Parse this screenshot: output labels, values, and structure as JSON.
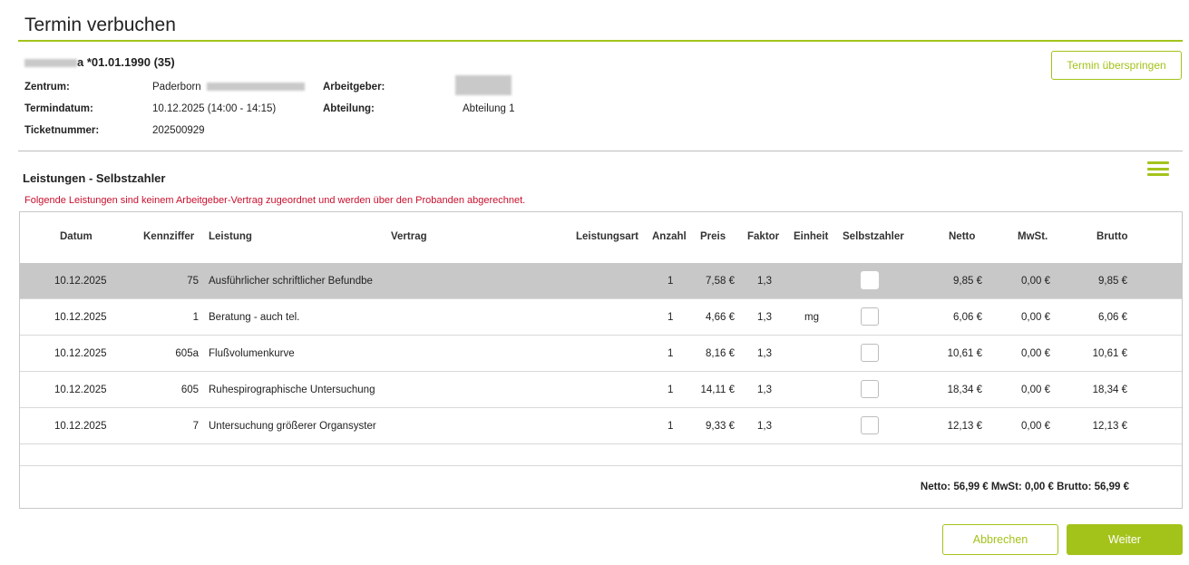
{
  "title": "Termin verbuchen",
  "patient": {
    "name_suffix": "a *01.01.1990 (35)"
  },
  "info": {
    "zentrum_label": "Zentrum:",
    "zentrum_value": "Paderborn",
    "termindatum_label": "Termindatum:",
    "termindatum_value": "10.12.2025 (14:00 - 14:15)",
    "ticketnummer_label": "Ticketnummer:",
    "ticketnummer_value": "202500929",
    "arbeitgeber_label": "Arbeitgeber:",
    "abteilung_label": "Abteilung:",
    "abteilung_value": "Abteilung 1"
  },
  "skip_button": "Termin überspringen",
  "section": {
    "title": "Leistungen - Selbstzahler",
    "notice": "Folgende Leistungen sind keinem Arbeitgeber-Vertrag zugeordnet und werden über den Probanden abgerechnet."
  },
  "columns": {
    "datum": "Datum",
    "kennziffer": "Kennziffer",
    "leistung": "Leistung",
    "vertrag": "Vertrag",
    "leistungsart": "Leistungsart",
    "anzahl": "Anzahl",
    "preis": "Preis",
    "faktor": "Faktor",
    "einheit": "Einheit",
    "selbstzahler": "Selbstzahler",
    "netto": "Netto",
    "mwst": "MwSt.",
    "brutto": "Brutto"
  },
  "rows": [
    {
      "datum": "10.12.2025",
      "kennziffer": "75",
      "leistung": "Ausführlicher schriftlicher Befundbe",
      "anzahl": "1",
      "preis": "7,58 €",
      "faktor": "1,3",
      "einheit": "",
      "netto": "9,85 €",
      "mwst": "0,00 €",
      "brutto": "9,85 €",
      "selected": true
    },
    {
      "datum": "10.12.2025",
      "kennziffer": "1",
      "leistung": "Beratung - auch tel.",
      "anzahl": "1",
      "preis": "4,66 €",
      "faktor": "1,3",
      "einheit": "mg",
      "netto": "6,06 €",
      "mwst": "0,00 €",
      "brutto": "6,06 €",
      "selected": false
    },
    {
      "datum": "10.12.2025",
      "kennziffer": "605a",
      "leistung": "Flußvolumenkurve",
      "anzahl": "1",
      "preis": "8,16 €",
      "faktor": "1,3",
      "einheit": "",
      "netto": "10,61 €",
      "mwst": "0,00 €",
      "brutto": "10,61 €",
      "selected": false
    },
    {
      "datum": "10.12.2025",
      "kennziffer": "605",
      "leistung": "Ruhespirographische Untersuchung",
      "anzahl": "1",
      "preis": "14,11 €",
      "faktor": "1,3",
      "einheit": "",
      "netto": "18,34 €",
      "mwst": "0,00 €",
      "brutto": "18,34 €",
      "selected": false
    },
    {
      "datum": "10.12.2025",
      "kennziffer": "7",
      "leistung": "Untersuchung größerer Organsyster",
      "anzahl": "1",
      "preis": "9,33 €",
      "faktor": "1,3",
      "einheit": "",
      "netto": "12,13 €",
      "mwst": "0,00 €",
      "brutto": "12,13 €",
      "selected": false
    }
  ],
  "totals": "Netto: 56,99 € MwSt: 0,00 € Brutto: 56,99 €",
  "buttons": {
    "cancel": "Abbrechen",
    "next": "Weiter"
  },
  "colors": {
    "accent": "#a3c31b",
    "notice": "#c8102e",
    "selected_row": "#c8c8c8"
  }
}
